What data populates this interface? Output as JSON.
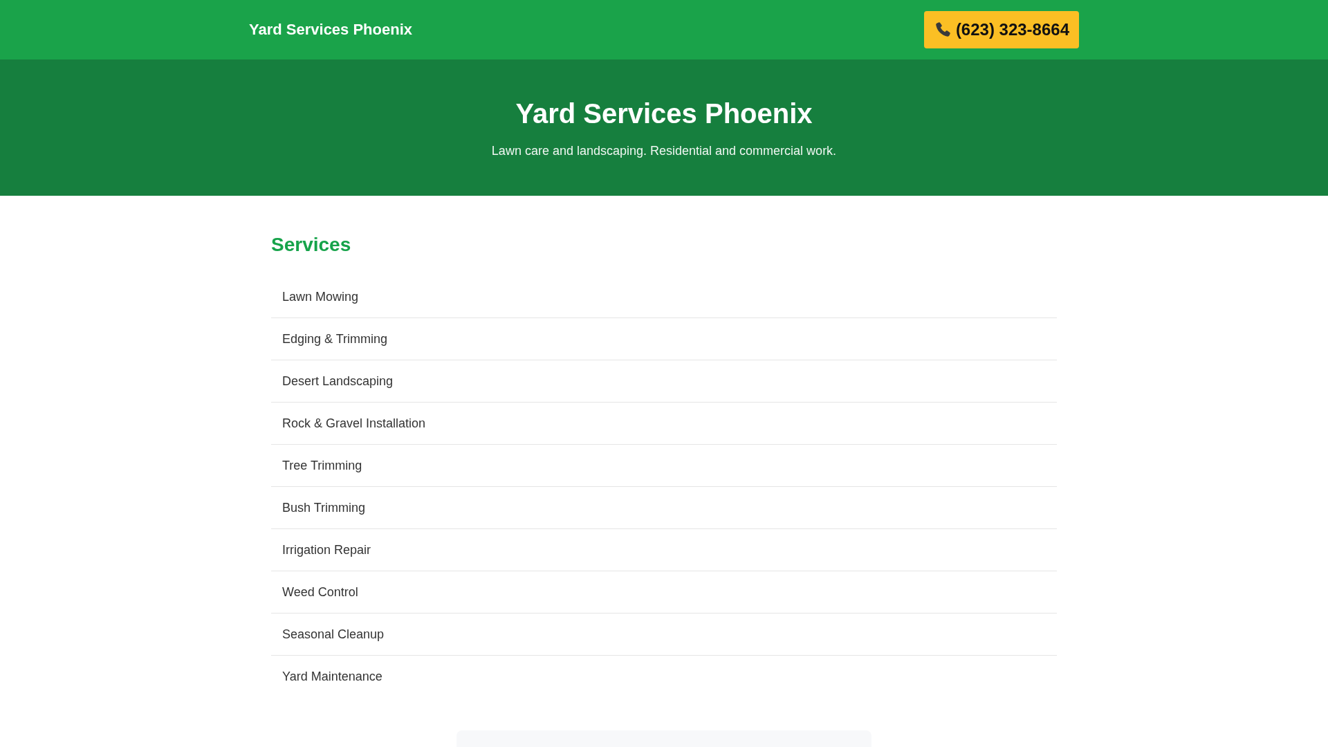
{
  "header": {
    "brand": "Yard Services Phoenix",
    "phone_button": {
      "label": "(623) 323-8664"
    }
  },
  "hero": {
    "title": "Yard Services Phoenix",
    "subtitle": "Lawn care and landscaping. Residential and commercial work."
  },
  "services": {
    "heading": "Services",
    "items": [
      "Lawn Mowing",
      "Edging & Trimming",
      "Desert Landscaping",
      "Rock & Gravel Installation",
      "Tree Trimming",
      "Bush Trimming",
      "Irrigation Repair",
      "Weed Control",
      "Seasonal Cleanup",
      "Yard Maintenance"
    ]
  }
}
